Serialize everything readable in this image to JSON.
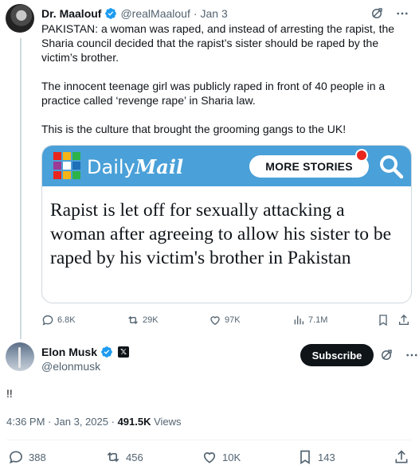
{
  "original_tweet": {
    "author_name": "Dr. Maalouf",
    "handle": "@realMaalouf",
    "separator": "·",
    "date": "Jan 3",
    "paragraphs": [
      "PAKISTAN: a woman was raped, and instead of arresting the rapist, the Sharia council decided that the rapist’s sister should be raped by the victim’s brother.",
      "The innocent teenage girl was publicly raped in front of 40 people in a practice called ‘revenge rape’ in Sharia law.",
      "This is the culture that brought the grooming gangs to the UK!"
    ],
    "card": {
      "brand_light": "Daily",
      "brand_bold": "Mail",
      "more_stories_label": "MORE STORIES",
      "headline": "Rapist is let off for sexually attacking a woman after agreeing to allow his sister to be raped by his victim's brother in Pakistan",
      "banner_color": "#4aa0d8",
      "logo_colors": [
        "#e8261e",
        "#f6b417",
        "#2cb34a",
        "#9b3b96",
        "#ffffff",
        "#1d6fb8",
        "#e8261e",
        "#f6b417",
        "#2cb34a"
      ]
    },
    "stats": {
      "replies": "6.8K",
      "reposts": "29K",
      "likes": "97K",
      "views": "7.1M"
    }
  },
  "reply_tweet": {
    "author_name": "Elon Musk",
    "handle": "@elonmusk",
    "x_badge": "𝕏",
    "subscribe_label": "Subscribe",
    "text": "!!",
    "time": "4:36 PM",
    "separator": "·",
    "date": "Jan 3, 2025",
    "views_count": "491.5K",
    "views_label": "Views",
    "stats": {
      "replies": "388",
      "reposts": "456",
      "likes": "10K",
      "bookmarks": "143"
    }
  },
  "colors": {
    "accent": "#1d9bf0",
    "muted": "#536471",
    "text": "#0f1419"
  },
  "icons": {
    "grok": "grok-icon",
    "more": "more-icon",
    "verified": "verified-badge-icon",
    "reply": "reply-icon",
    "repost": "repost-icon",
    "like": "like-icon",
    "views": "views-icon",
    "bookmark": "bookmark-icon",
    "share": "share-icon",
    "search": "search-icon"
  }
}
